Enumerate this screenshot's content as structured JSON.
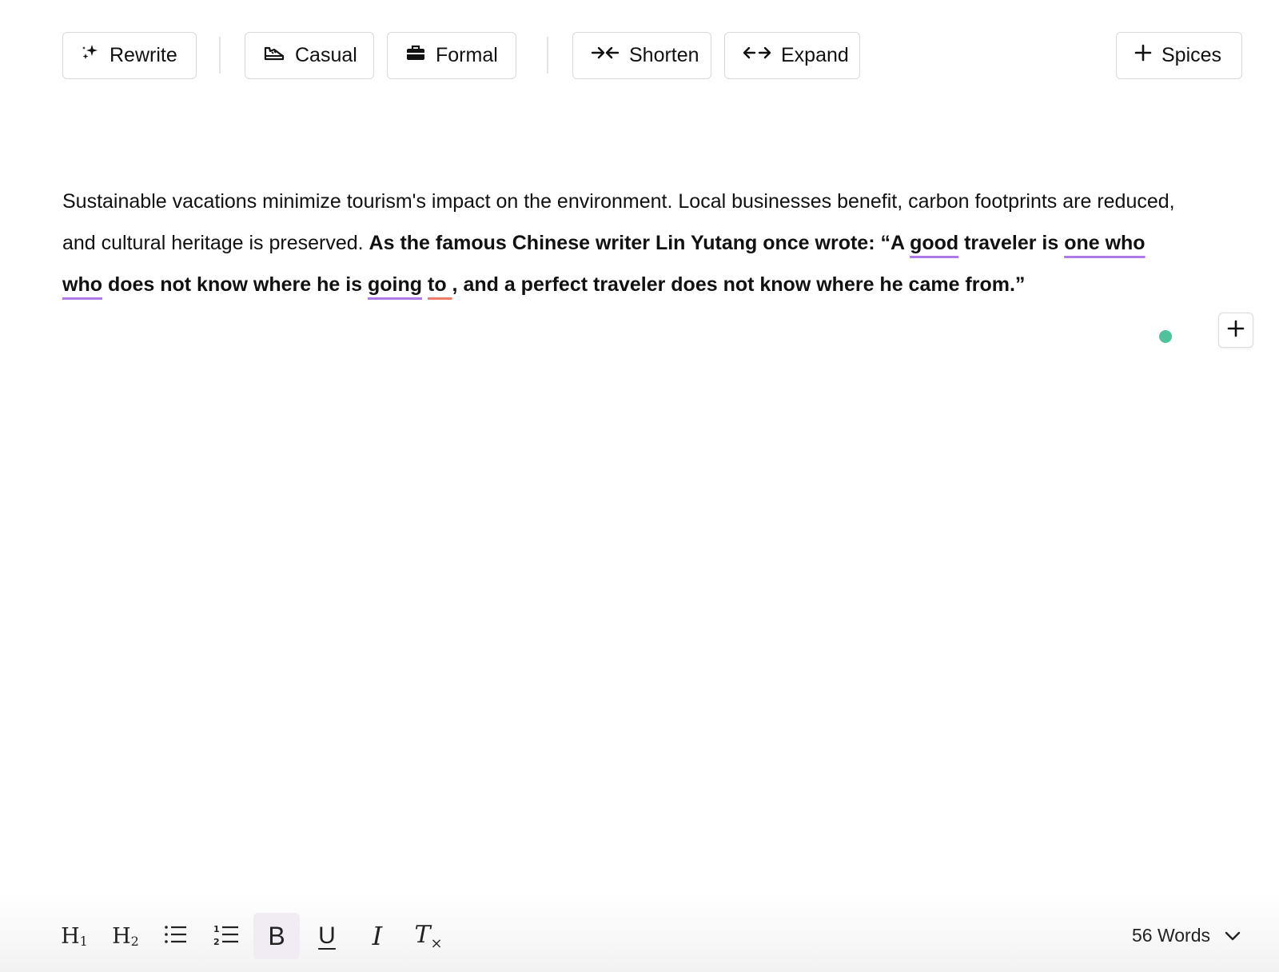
{
  "top_toolbar": {
    "rewrite_label": "Rewrite",
    "casual_label": "Casual",
    "formal_label": "Formal",
    "shorten_label": "Shorten",
    "expand_label": "Expand",
    "spices_label": "Spices"
  },
  "editor": {
    "plain_text": "Sustainable vacations minimize tourism's impact on the environment. Local businesses benefit, carbon footprints are reduced, and cultural heritage is preserved. ",
    "bold_1": "As the famous Chinese writer Lin Yutang once wrote: “A ",
    "suggest_1": "good",
    "bold_2": " traveler is ",
    "suggest_2": "one who who",
    "bold_3": " does not know where he is ",
    "suggest_3": "going",
    "bold_4": " ",
    "error_1": "to ",
    "bold_5": ", and a perfect traveler does not know where he came from.”"
  },
  "bottom_toolbar": {
    "h1_main": "H",
    "h1_sub": "1",
    "h2_main": "H",
    "h2_sub": "2",
    "bold_glyph": "B",
    "underline_glyph": "U",
    "italic_glyph": "I",
    "clear_glyph": "T",
    "clear_sub": "×",
    "word_count": "56 Words"
  },
  "colors": {
    "suggestion_underline": "#b07ae6",
    "error_underline": "#ee7a6b",
    "status_dot": "#4fc29b",
    "active_format_bg": "#f1ecf3"
  },
  "icons": [
    "sparkle-icon",
    "sneaker-icon",
    "briefcase-icon",
    "shorten-arrows-icon",
    "expand-arrows-icon",
    "plus-icon",
    "h1-icon",
    "h2-icon",
    "bullet-list-icon",
    "numbered-list-icon",
    "bold-icon",
    "underline-icon",
    "italic-icon",
    "clear-format-icon",
    "chevron-down-icon"
  ]
}
